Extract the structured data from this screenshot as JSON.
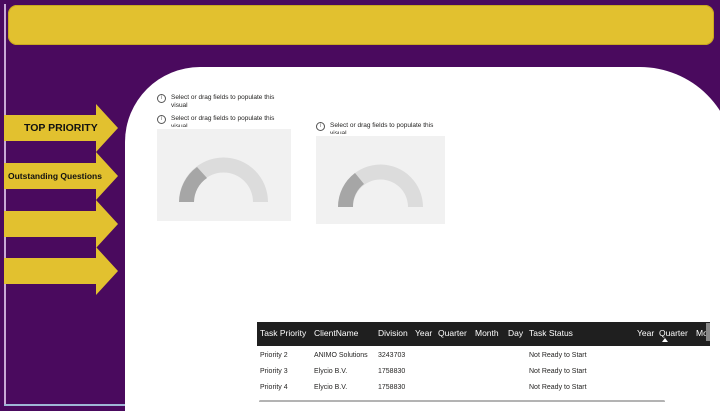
{
  "theme": {
    "accent": "#e2c12f",
    "background": "#4a0a5e",
    "table_header": "#1f1f1f"
  },
  "nav": {
    "arrows": [
      "TOP PRIORITY",
      "Outstanding Questions",
      "",
      ""
    ]
  },
  "placeholders": [
    {
      "icon": "info-icon",
      "text": "Select or drag fields to populate this visual"
    },
    {
      "icon": "info-icon",
      "text": "Select or drag fields to populate this visual"
    },
    {
      "icon": "info-icon",
      "text": "Select or drag fields to populate this visual"
    }
  ],
  "table": {
    "columns": [
      "Task Priority",
      "ClientName",
      "Division",
      "Year",
      "Quarter",
      "Month",
      "Day",
      "Task Status",
      "Year",
      "Quarter",
      "Mo"
    ],
    "rows": [
      [
        "Priority 2",
        "ANIMO Solutions",
        "3243703",
        "",
        "",
        "",
        "",
        "Not Ready to Start"
      ],
      [
        "Priority 3",
        "Elycio B.V.",
        "1758830",
        "",
        "",
        "",
        "",
        "Not Ready to Start"
      ],
      [
        "Priority 4",
        "Elycio B.V.",
        "1758830",
        "",
        "",
        "",
        "",
        "Not Ready to Start"
      ]
    ]
  }
}
